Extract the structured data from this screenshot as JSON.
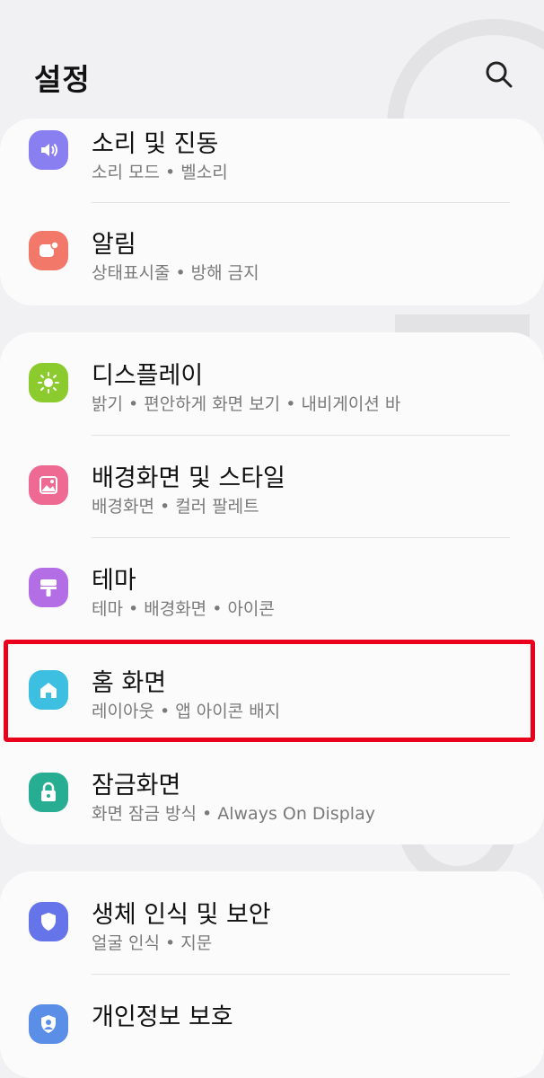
{
  "header": {
    "title": "설정"
  },
  "colors": {
    "highlight": "#e8001c"
  },
  "groups": [
    {
      "items": [
        {
          "label": "소리 및 진동",
          "subtitle": "소리 모드 • 벨소리",
          "icon": "speaker-icon",
          "color": "#8a7ff0"
        },
        {
          "label": "알림",
          "subtitle": "상태표시줄 • 방해 금지",
          "icon": "notification-icon",
          "color": "#f2786a"
        }
      ]
    },
    {
      "items": [
        {
          "label": "디스플레이",
          "subtitle": "밝기 • 편안하게 화면 보기 • 내비게이션 바",
          "icon": "brightness-icon",
          "color": "#8ccb2e"
        },
        {
          "label": "배경화면 및 스타일",
          "subtitle": "배경화면 • 컬러 팔레트",
          "icon": "image-icon",
          "color": "#ee6a92"
        },
        {
          "label": "테마",
          "subtitle": "테마 • 배경화면 • 아이콘",
          "icon": "paint-brush-icon",
          "color": "#b36ee6"
        },
        {
          "label": "홈 화면",
          "subtitle": "레이아웃 • 앱 아이콘 배지",
          "icon": "home-icon",
          "color": "#3cbfe0"
        },
        {
          "label": "잠금화면",
          "subtitle": "화면 잠금 방식 • Always On Display",
          "icon": "lock-icon",
          "color": "#27ad91"
        }
      ]
    },
    {
      "items": [
        {
          "label": "생체 인식 및 보안",
          "subtitle": "얼굴 인식 • 지문",
          "icon": "shield-icon",
          "color": "#6674ea"
        },
        {
          "label": "개인정보 보호",
          "subtitle": "",
          "icon": "privacy-icon",
          "color": "#5b8ee6"
        }
      ]
    }
  ]
}
